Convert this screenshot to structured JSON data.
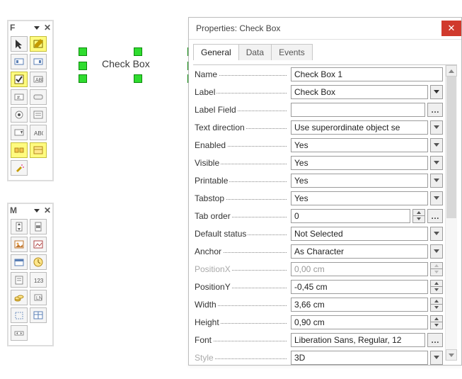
{
  "toolbars": {
    "form_controls": {
      "title": "F"
    },
    "more_controls": {
      "title": "M"
    }
  },
  "design_control": {
    "label": "Check Box"
  },
  "dialog": {
    "title": "Properties: Check Box",
    "tabs": [
      "General",
      "Data",
      "Events"
    ],
    "active_tab": 0,
    "fields": {
      "name": {
        "label": "Name",
        "value": "Check Box 1"
      },
      "label": {
        "label": "Label",
        "value": "Check Box"
      },
      "label_field": {
        "label": "Label Field",
        "value": ""
      },
      "text_direction": {
        "label": "Text direction",
        "value": "Use superordinate object se"
      },
      "enabled": {
        "label": "Enabled",
        "value": "Yes"
      },
      "visible": {
        "label": "Visible",
        "value": "Yes"
      },
      "printable": {
        "label": "Printable",
        "value": "Yes"
      },
      "tabstop": {
        "label": "Tabstop",
        "value": "Yes"
      },
      "tab_order": {
        "label": "Tab order",
        "value": "0"
      },
      "default_status": {
        "label": "Default status",
        "value": "Not Selected"
      },
      "anchor": {
        "label": "Anchor",
        "value": "As Character"
      },
      "position_x": {
        "label": "PositionX",
        "value": "0,00 cm"
      },
      "position_y": {
        "label": "PositionY",
        "value": "-0,45 cm"
      },
      "width": {
        "label": "Width",
        "value": "3,66 cm"
      },
      "height": {
        "label": "Height",
        "value": "0,90 cm"
      },
      "font": {
        "label": "Font",
        "value": "Liberation Sans, Regular, 12"
      },
      "style": {
        "label": "Style",
        "value": "3D"
      }
    }
  }
}
